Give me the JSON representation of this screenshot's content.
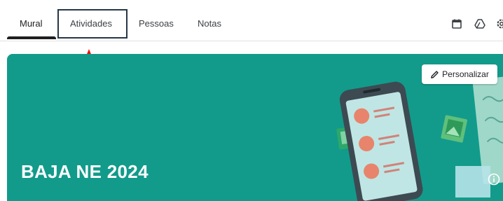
{
  "tabs": [
    {
      "label": "Mural",
      "active": true
    },
    {
      "label": "Atividades",
      "active": false
    },
    {
      "label": "Pessoas",
      "active": false
    },
    {
      "label": "Notas",
      "active": false
    }
  ],
  "toolbar_icons": [
    "calendar-icon",
    "drive-icon",
    "settings-icon"
  ],
  "banner": {
    "title": "BAJA NE 2024",
    "customize_label": "Personalizar",
    "background_color": "#129b8b"
  },
  "annotation": {
    "color": "#e8140c",
    "box_color": "#253746"
  }
}
